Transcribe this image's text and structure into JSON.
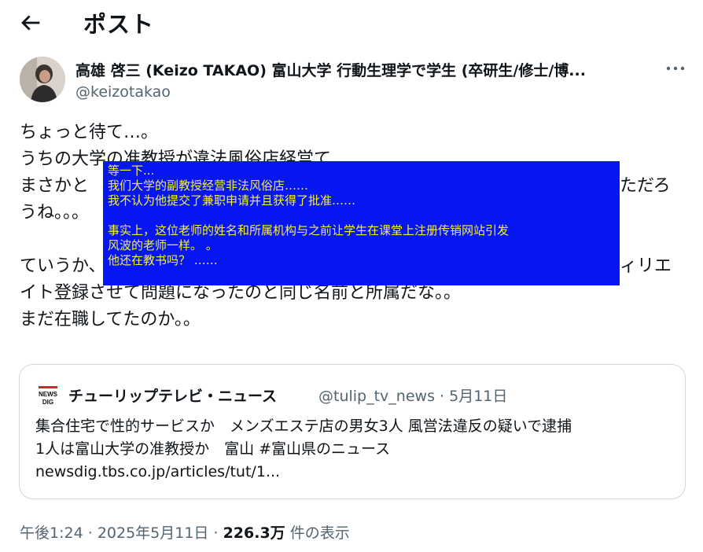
{
  "header": {
    "title": "ポスト"
  },
  "author": {
    "name": "高雄 啓三 (Keizo TAKAO) 富山大学 行動生理学で学生 (卒研生/修士/博...",
    "handle": "@keizotakao"
  },
  "post": {
    "lines": [
      "ちょっと待て…。",
      "うちの大学の准教授が違法風俗店経営て",
      "まさかと",
      "うね。。。"
    ],
    "line3_end": "ただろ",
    "line5": "ていうか、",
    "line5_end": "ィリエ",
    "lines_after": [
      "イト登録させて問題になったのと同じ名前と所属だな。。",
      "まだ在職してたのか。。"
    ]
  },
  "overlay": {
    "lines": [
      "等一下...",
      "我们大学的副教授经营非法风俗店……",
      "我不认为他提交了兼职申请并且获得了批准……",
      "",
      "事实上，这位老师的姓名和所属机构与之前让学生在课堂上注册传销网站引发",
      "风波的老师一样。 。",
      "他还在教书吗？ ……"
    ]
  },
  "quote": {
    "source_name": "チューリップテレビ・ニュース",
    "source_handle": "@tulip_tv_news",
    "separator": "·",
    "date": "5月11日",
    "line1": "集合住宅で性的サービスか　メンズエステ店の男女3人 風営法違反の疑いで逮捕",
    "line2": "1人は富山大学の准教授か　富山 #富山県のニュース",
    "link": "newsdig.tbs.co.jp/articles/tut/1..."
  },
  "footer": {
    "time": "午後1:24",
    "dot1": "·",
    "date": "2025年5月11日",
    "dot2": "·",
    "views": "226.3万",
    "views_label": "件の表示"
  },
  "icons": {
    "back": "arrow-left-icon",
    "more": "more-horizontal-icon",
    "logo": "news-dig-logo"
  },
  "colors": {
    "overlay_bg": "#0616f2",
    "overlay_text": "#f6f03c",
    "secondary_text": "#536471",
    "border": "#cfd9de"
  }
}
